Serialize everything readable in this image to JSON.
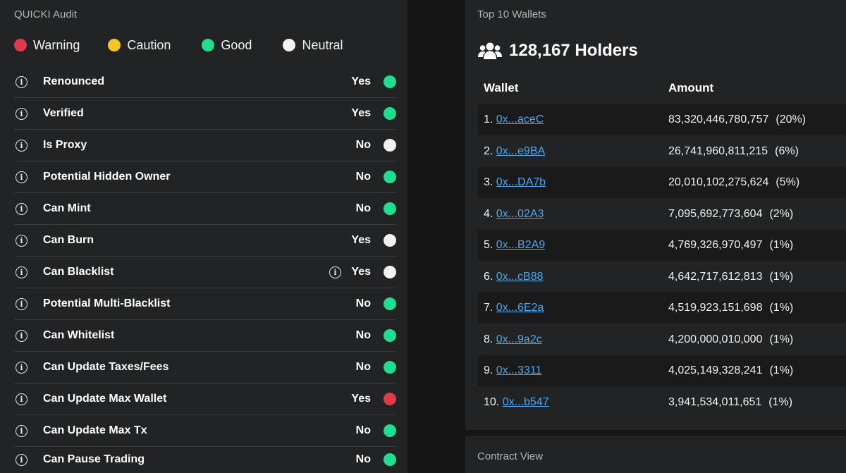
{
  "audit": {
    "title": "QUICKI Audit",
    "legend": [
      {
        "label": "Warning",
        "color": "#e03a4e"
      },
      {
        "label": "Caution",
        "color": "#f5c524"
      },
      {
        "label": "Good",
        "color": "#1fdf8f"
      },
      {
        "label": "Neutral",
        "color": "#f2f2f2"
      }
    ],
    "rows": [
      {
        "label": "Renounced",
        "value": "Yes",
        "status": "good"
      },
      {
        "label": "Verified",
        "value": "Yes",
        "status": "good"
      },
      {
        "label": "Is Proxy",
        "value": "No",
        "status": "neutral"
      },
      {
        "label": "Potential Hidden Owner",
        "value": "No",
        "status": "good"
      },
      {
        "label": "Can Mint",
        "value": "No",
        "status": "good"
      },
      {
        "label": "Can Burn",
        "value": "Yes",
        "status": "neutral"
      },
      {
        "label": "Can Blacklist",
        "value": "Yes",
        "status": "neutral",
        "extra_info": true
      },
      {
        "label": "Potential Multi-Blacklist",
        "value": "No",
        "status": "good"
      },
      {
        "label": "Can Whitelist",
        "value": "No",
        "status": "good"
      },
      {
        "label": "Can Update Taxes/Fees",
        "value": "No",
        "status": "good"
      },
      {
        "label": "Can Update Max Wallet",
        "value": "Yes",
        "status": "warning"
      },
      {
        "label": "Can Update Max Tx",
        "value": "No",
        "status": "good"
      },
      {
        "label": "Can Pause Trading",
        "value": "No",
        "status": "good"
      }
    ],
    "status_colors": {
      "warning": "#e03a4e",
      "caution": "#f5c524",
      "good": "#1fdf8f",
      "neutral": "#f2f2f2"
    }
  },
  "wallets": {
    "title": "Top 10 Wallets",
    "holders_icon": "users-icon",
    "holders_text": "128,167 Holders",
    "columns": [
      "Wallet",
      "Amount"
    ],
    "rows": [
      {
        "rank": "1.",
        "address": "0x...aceC",
        "amount": "83,320,446,780,757",
        "percent": "(20%)"
      },
      {
        "rank": "2.",
        "address": "0x...e9BA",
        "amount": "26,741,960,811,215",
        "percent": "(6%)"
      },
      {
        "rank": "3.",
        "address": "0x...DA7b",
        "amount": "20,010,102,275,624",
        "percent": "(5%)"
      },
      {
        "rank": "4.",
        "address": "0x...02A3",
        "amount": "7,095,692,773,604",
        "percent": "(2%)"
      },
      {
        "rank": "5.",
        "address": "0x...B2A9",
        "amount": "4,769,326,970,497",
        "percent": "(1%)"
      },
      {
        "rank": "6.",
        "address": "0x...cB88",
        "amount": "4,642,717,612,813",
        "percent": "(1%)"
      },
      {
        "rank": "7.",
        "address": "0x...6E2a",
        "amount": "4,519,923,151,698",
        "percent": "(1%)"
      },
      {
        "rank": "8.",
        "address": "0x...9a2c",
        "amount": "4,200,000,010,000",
        "percent": "(1%)"
      },
      {
        "rank": "9.",
        "address": "0x...3311",
        "amount": "4,025,149,328,241",
        "percent": "(1%)"
      },
      {
        "rank": "10.",
        "address": "0x...b547",
        "amount": "3,941,534,011,651",
        "percent": "(1%)"
      }
    ]
  },
  "contract": {
    "title": "Contract View"
  }
}
